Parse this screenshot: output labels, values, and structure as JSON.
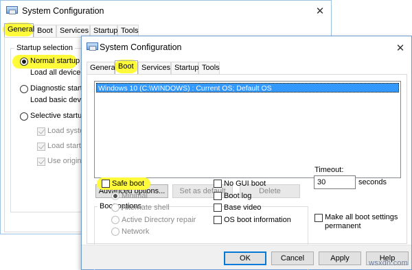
{
  "back_window": {
    "title": "System Configuration",
    "tabs": [
      "General",
      "Boot",
      "Services",
      "Startup",
      "Tools"
    ],
    "selected_tab": "General",
    "startup_group_title": "Startup selection",
    "normal_startup": {
      "label": "Normal startup",
      "description": "Load all device dri",
      "selected": true
    },
    "diagnostic_startup": {
      "label": "Diagnostic startup",
      "description": "Load basic devices",
      "selected": false
    },
    "selective_startup": {
      "label": "Selective startup",
      "selected": false
    },
    "selective_options": [
      {
        "label": "Load system",
        "checked": true
      },
      {
        "label": "Load startup",
        "checked": true
      },
      {
        "label": "Use original",
        "checked": true
      }
    ]
  },
  "front_window": {
    "title": "System Configuration",
    "tabs": [
      "General",
      "Boot",
      "Services",
      "Startup",
      "Tools"
    ],
    "selected_tab": "Boot",
    "os_entries": [
      "Windows 10 (C:\\WINDOWS) : Current OS; Default OS"
    ],
    "buttons": {
      "advanced_options": "Advanced options...",
      "set_as_default": "Set as default",
      "delete": "Delete"
    },
    "boot_options": {
      "title": "Boot options",
      "safe_boot": {
        "label": "Safe boot",
        "checked": false
      },
      "safe_boot_modes": [
        "Minimal",
        "Alternate shell",
        "Active Directory repair",
        "Network"
      ],
      "selected_mode": "Minimal",
      "right_checks": [
        {
          "label": "No GUI boot",
          "checked": false
        },
        {
          "label": "Boot log",
          "checked": false
        },
        {
          "label": "Base video",
          "checked": false
        },
        {
          "label": "OS boot information",
          "checked": false
        }
      ]
    },
    "timeout": {
      "label": "Timeout:",
      "value": "30",
      "unit": "seconds"
    },
    "make_permanent": {
      "label_line1": "Make all boot settings",
      "label_line2": "permanent",
      "checked": false
    },
    "footer_buttons": {
      "ok": "OK",
      "cancel": "Cancel",
      "apply": "Apply",
      "help": "Help"
    }
  },
  "highlight_color": "#fffb3a",
  "accent_color": "#0078d7",
  "selection_color": "#3399ff",
  "watermark": "wsxdn.com",
  "icons": [
    "msconfig-icon",
    "close-icon",
    "radio-icon",
    "checkbox-icon"
  ]
}
